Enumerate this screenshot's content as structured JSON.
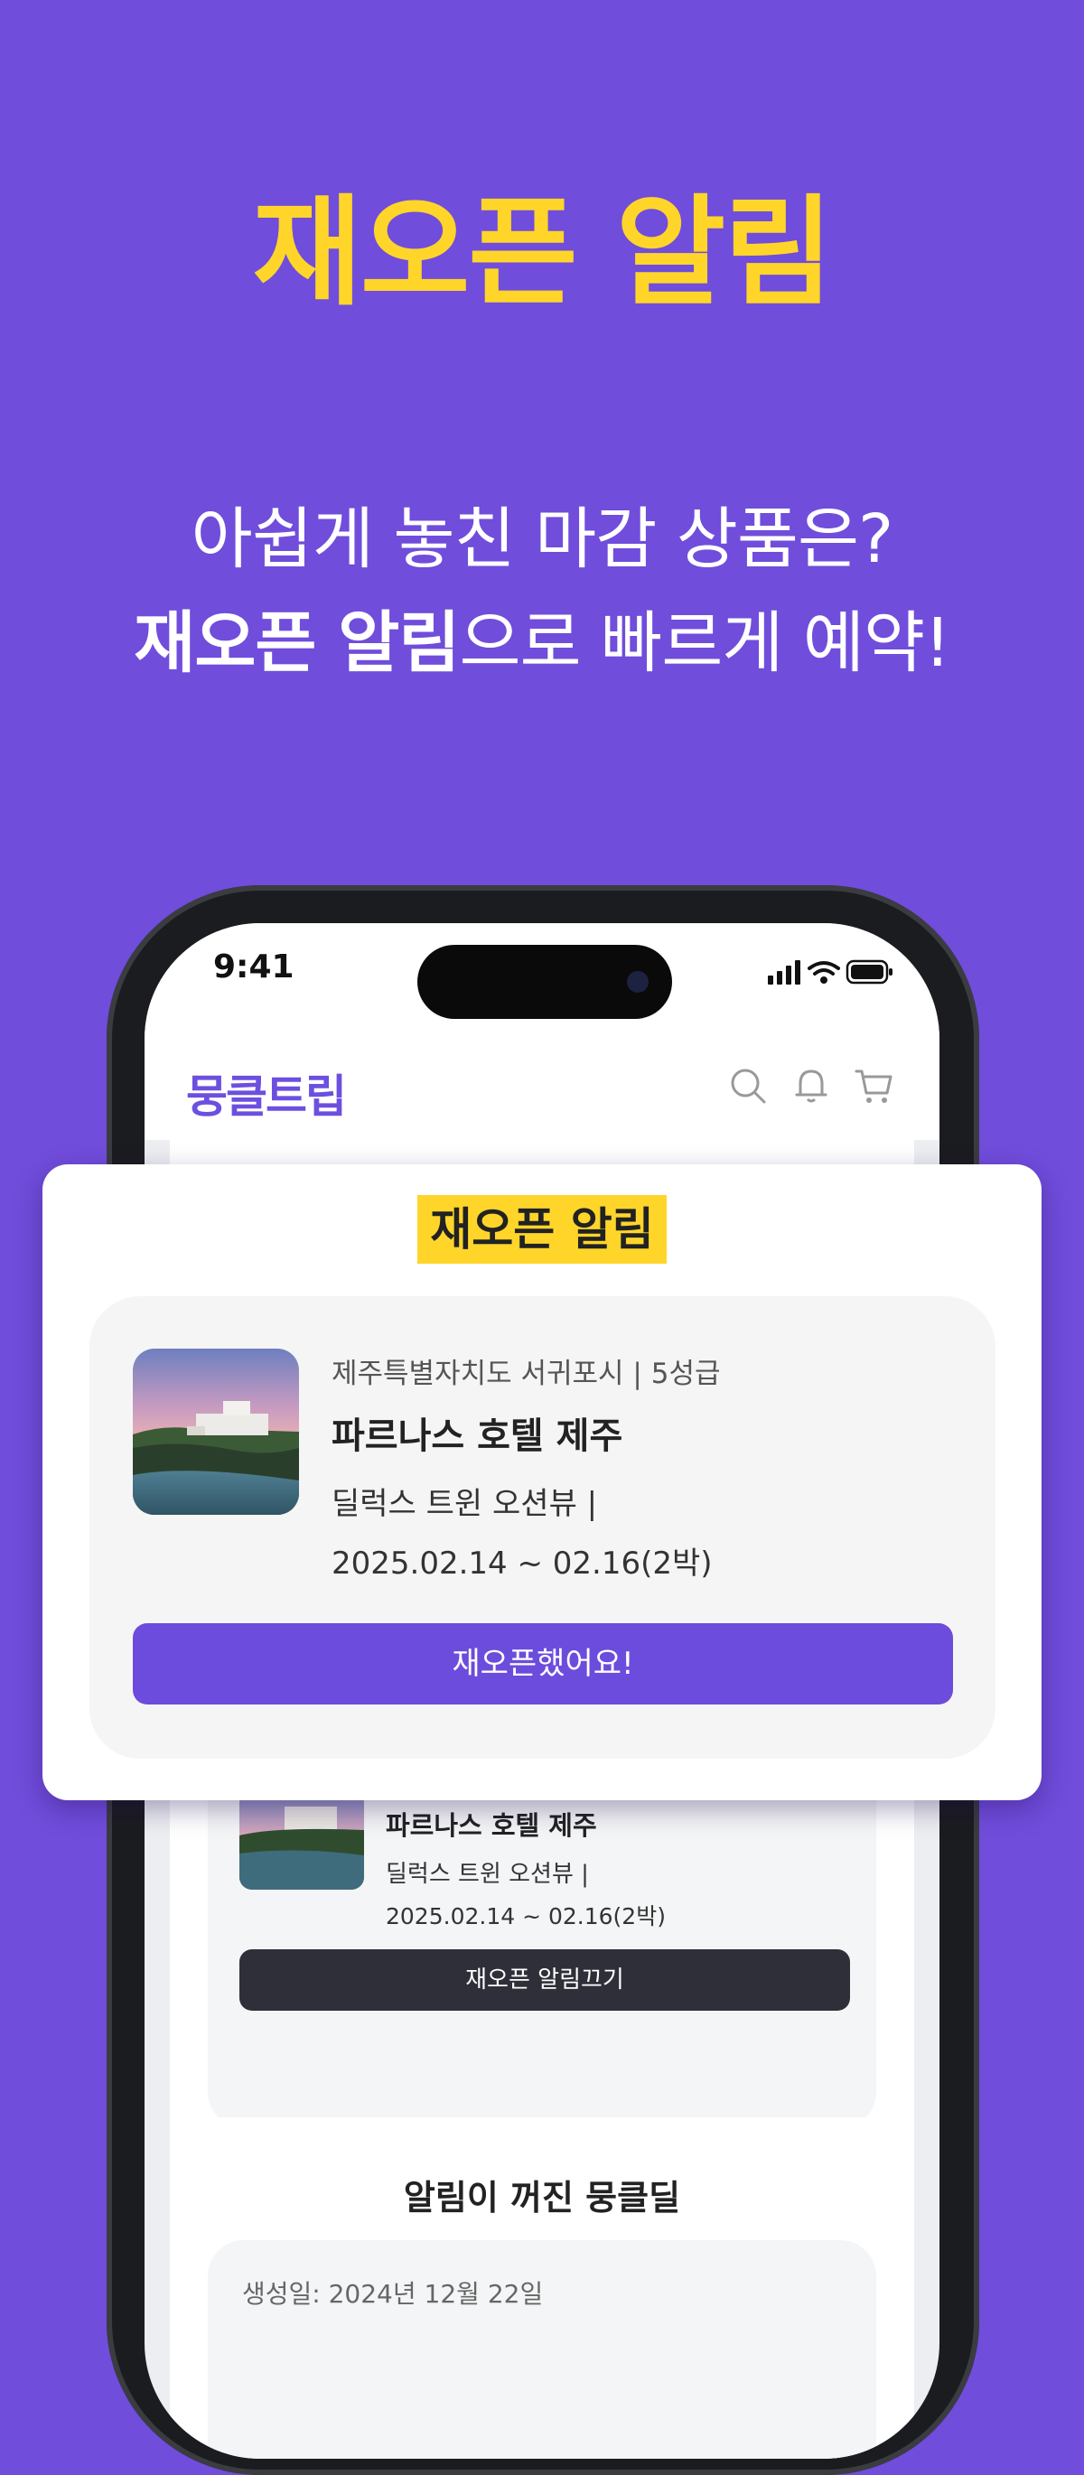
{
  "hero": {
    "headline": "재오픈 알림",
    "line1": "아쉽게 놓친 마감 상품은?",
    "line2_bold": "재오픈 알림",
    "line2_rest": "으로 빠르게 예약!"
  },
  "status": {
    "time": "9:41"
  },
  "app": {
    "logo": "뭉클트립",
    "icons": [
      "search-icon",
      "bell-icon",
      "cart-icon"
    ]
  },
  "popup": {
    "title": "재오픈 알림",
    "location": "제주특별자치도 서귀포시 | 5성급",
    "hotel_name": "파르나스 호텔 제주",
    "room": "딜럭스 트윈 오션뷰 |",
    "dates": "2025.02.14 ~ 02.16(2박)",
    "button": "재오픈했어요!"
  },
  "list_card": {
    "hotel_name": "파르나스 호텔 제주",
    "room": "딜럭스 트윈 오션뷰 |",
    "dates": "2025.02.14 ~ 02.16(2박)",
    "button": "재오픈 알림끄기"
  },
  "off_section": {
    "title": "알림이 꺼진 뭉클딜",
    "created": "생성일: 2024년 12월 22일"
  },
  "colors": {
    "background": "#704ddb",
    "accent_yellow": "#ffd52a",
    "primary_button": "#6c4cdc",
    "dark_button": "#2e2f38"
  }
}
